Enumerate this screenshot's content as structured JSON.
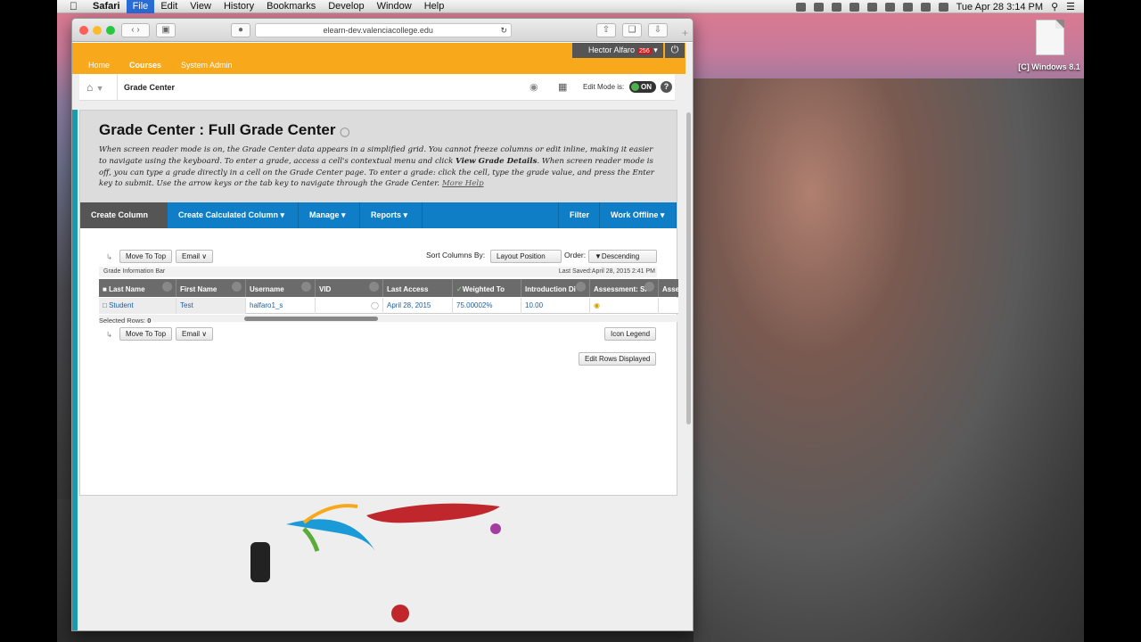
{
  "menubar": {
    "apple": "",
    "app": "Safari",
    "items": [
      "File",
      "Edit",
      "View",
      "History",
      "Bookmarks",
      "Develop",
      "Window",
      "Help"
    ],
    "active": "File",
    "clock": "Tue Apr 28  3:14 PM"
  },
  "desktop": {
    "icon_label": "[C] Windows 8.1"
  },
  "browser": {
    "url": "elearn-dev.valenciacollege.edu"
  },
  "bb": {
    "user": "Hector Alfaro",
    "user_badge": "256",
    "tabs": [
      "Home",
      "Courses",
      "System Admin"
    ],
    "breadcrumb": "Grade Center",
    "edit_mode_label": "Edit Mode is:",
    "edit_mode_value": "ON",
    "title": "Grade Center : Full Grade Center",
    "desc_1": "When screen reader mode is on, the Grade Center data appears in a simplified grid. You cannot freeze columns or edit inline, making it easier to navigate using the keyboard. To enter a grade, access a cell's contextual menu and click ",
    "desc_bold": "View Grade Details",
    "desc_2": ". When screen reader mode is off, you can type a grade directly in a cell on the Grade Center page. To enter a grade: click the cell, type the grade value, and press the Enter key to submit. Use the arrow keys or the tab key to navigate through the Grade Center. ",
    "desc_link": "More Help",
    "actions": [
      "Create Column",
      "Create Calculated Column",
      "Manage",
      "Reports",
      "Filter",
      "Work Offline"
    ],
    "move_to_top": "Move To Top",
    "email": "Email",
    "sort_label": "Sort Columns By:",
    "sort_value": "Layout Position",
    "order_label": "Order:",
    "order_value": "▼Descending",
    "info_bar": "Grade Information Bar",
    "last_saved": "Last Saved:April 28, 2015 2:41 PM",
    "columns": [
      "Last Name",
      "First Name",
      "Username",
      "VID",
      "Last Access",
      "Weighted To",
      "Introduction Di",
      "Assessment: Si",
      "Assess"
    ],
    "row": [
      "Student",
      "Test",
      "halfaro1_s",
      "",
      "April 28, 2015",
      "75.00002%",
      "10.00",
      "",
      ""
    ],
    "selected_rows_label": "Selected Rows:",
    "selected_rows_value": "0",
    "icon_legend": "Icon Legend",
    "edit_rows": "Edit Rows Displayed"
  }
}
